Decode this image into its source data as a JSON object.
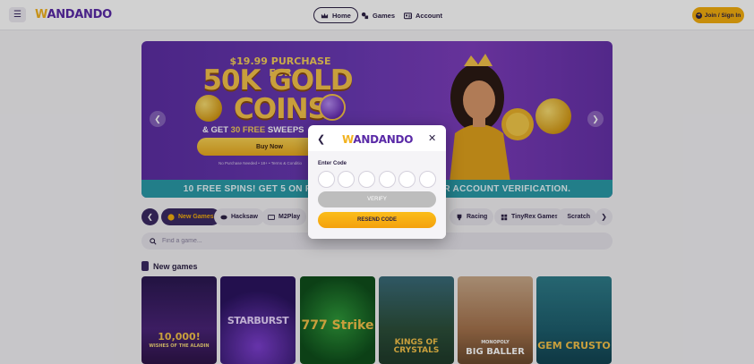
{
  "header": {
    "menu_icon": "hamburger-icon",
    "logo": "WANDANDO",
    "logo_first_letter": "W",
    "logo_rest": "ANDANDO",
    "nav": [
      {
        "label": "Home",
        "icon": "crown-icon",
        "active": true
      },
      {
        "label": "Games",
        "icon": "game-pieces-icon",
        "active": false
      },
      {
        "label": "Account",
        "icon": "id-card-icon",
        "active": false
      }
    ],
    "join_label": "Join / Sign In"
  },
  "banner": {
    "line1": "$19.99 PURCHASE FOR",
    "line2": "50K GOLD",
    "line3": "COINS",
    "line4_prefix": "& GET ",
    "line4_highlight": "30 FREE",
    "line4_suffix": " SWEEPS",
    "buy_label": "Buy Now",
    "fineprint": "No Purchase Needed • 18+ • Terms & Conditio",
    "bottom_text": "10 FREE SPINS! GET 5 ON F",
    "bottom_text_right": "R ACCOUNT VERIFICATION."
  },
  "categories": [
    {
      "label": "New Games",
      "icon": "new-icon",
      "active": true
    },
    {
      "label": "Hacksaw",
      "icon": "mask-icon",
      "active": false
    },
    {
      "label": "M2Play",
      "icon": "m2-icon",
      "active": false
    },
    {
      "label": "Racing",
      "icon": "trophy-icon",
      "active": false
    },
    {
      "label": "TinyRex Games",
      "icon": "grid-icon",
      "active": false
    },
    {
      "label": "Scratch",
      "icon": "scratch-icon",
      "active": false
    }
  ],
  "search": {
    "placeholder": "Find a game..."
  },
  "new_games": {
    "title": "New games",
    "games": [
      {
        "title": "10,000!",
        "subtitle": "WISHES OF THE ALADIN"
      },
      {
        "title": "STARBURST"
      },
      {
        "title": "777 Strike"
      },
      {
        "title": "KINGS OF CRYSTALS"
      },
      {
        "title": "BIG BALLER",
        "subtitle": "MONOPOLY"
      },
      {
        "title": "GEM CRUSTO"
      }
    ]
  },
  "modal": {
    "logo_first_letter": "W",
    "logo_rest": "ANDANDO",
    "enter_code_label": "Enter Code",
    "code_digits": [
      "",
      "",
      "",
      "",
      "",
      ""
    ],
    "verify_label": "VERIFY",
    "resend_label": "RESEND CODE"
  },
  "colors": {
    "brand_purple": "#5a2aa7",
    "accent_gold": "#f3ae0f",
    "dark_navy": "#2c2145"
  }
}
